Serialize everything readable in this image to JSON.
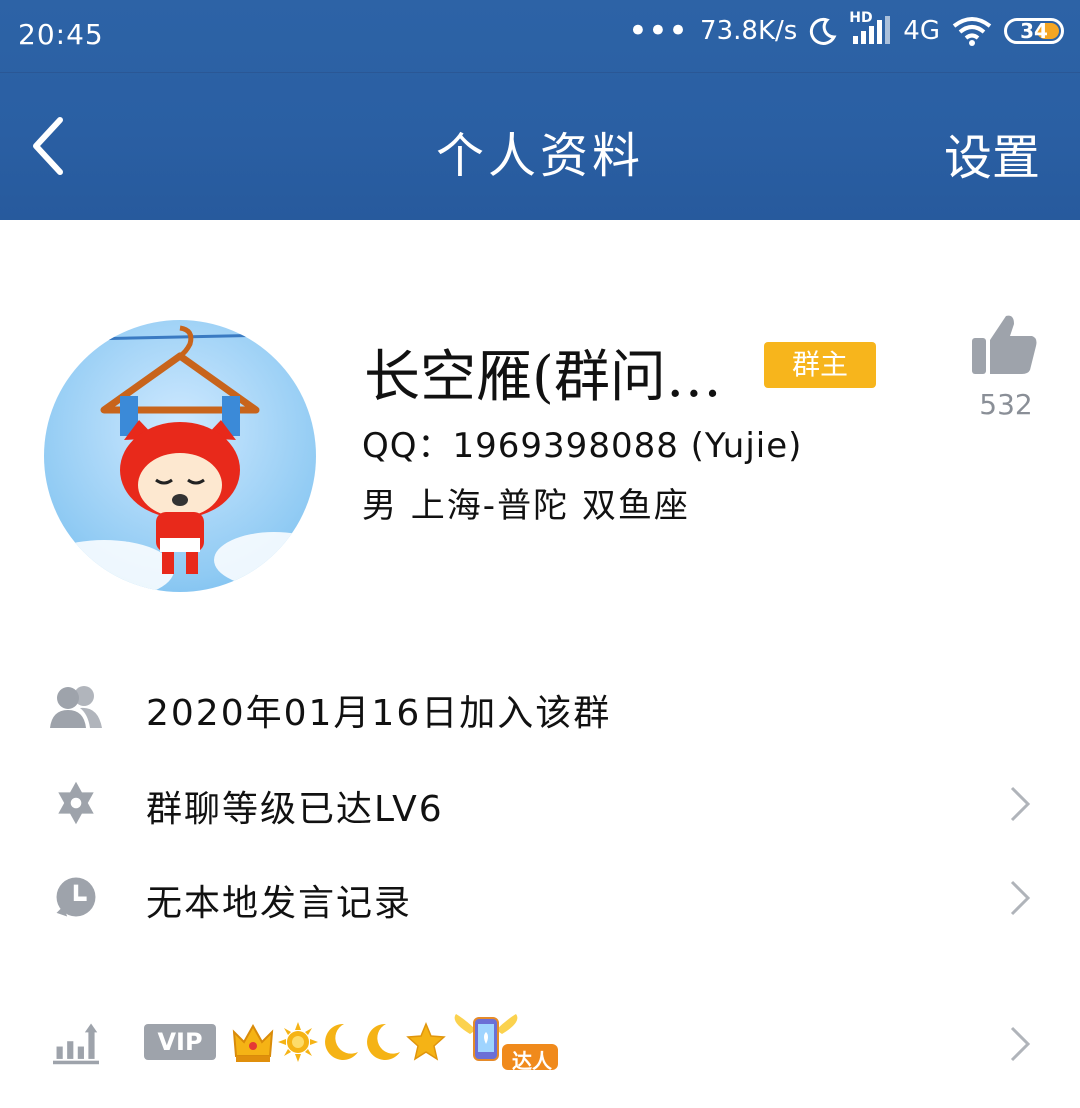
{
  "status_bar": {
    "time": "20:45",
    "network_speed": "73.8K/s",
    "network_type": "4G",
    "hd_label": "HD",
    "battery": "34"
  },
  "nav": {
    "title": "个人资料",
    "settings_label": "设置"
  },
  "profile": {
    "name": "长空雁(群问…",
    "role_badge": "群主",
    "like_count": "532",
    "qq_line": "QQ：1969398088 (Yujie)",
    "info_line": "男  上海-普陀  双鱼座"
  },
  "rows": [
    {
      "text": "2020年01月16日加入该群",
      "icon": "group-icon",
      "has_chevron": false
    },
    {
      "text": "群聊等级已达LV6",
      "icon": "star-of-david-icon",
      "has_chevron": true
    },
    {
      "text": "无本地发言记录",
      "icon": "clock-icon",
      "has_chevron": true
    }
  ],
  "vip_row": {
    "vip_label": "VIP",
    "icons": [
      "crown-icon",
      "sun-icon",
      "moon-icon",
      "moon-icon",
      "star-icon",
      "angel-phone-icon"
    ],
    "daren_label": "达人"
  },
  "colors": {
    "header": "#2a5fa3",
    "badge": "#f7b51c",
    "icon_gray": "#9ea3ab"
  }
}
